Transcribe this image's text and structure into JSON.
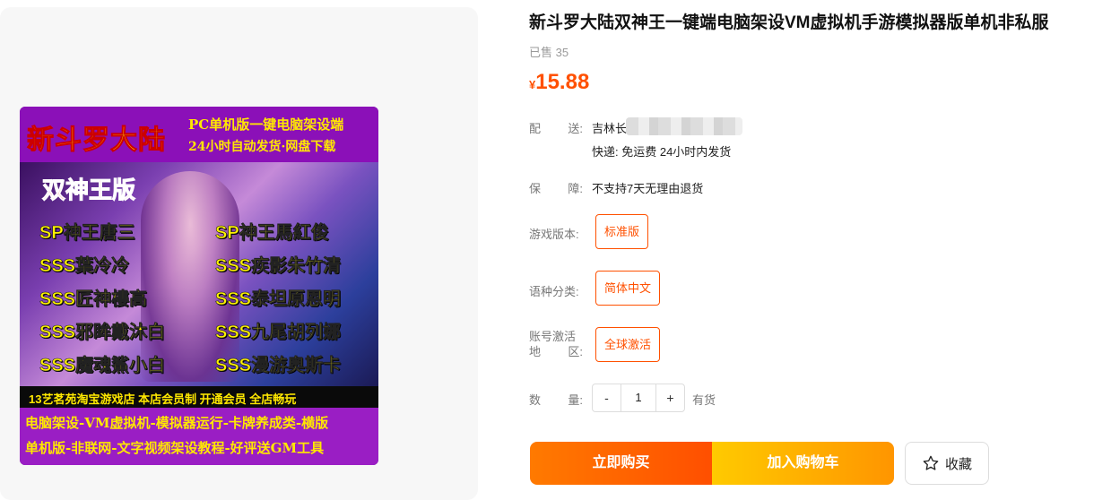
{
  "gallery": {
    "cover": {
      "title": "新斗罗大陆",
      "subtitle_line1": "PC单机版一键电脑架设端",
      "subtitle_line2": "24小时自动发货·网盘下载",
      "badge": "双神王版",
      "heroes_left": [
        "SP神王唐三",
        "SSS葉冷冷",
        "SSS匠神樓高",
        "SSS邪眸戴沐白",
        "SSS魔魂鯊小白"
      ],
      "heroes_right": [
        "SP神王馬紅俊",
        "SSS疾影朱竹清",
        "SSS泰坦原恩明",
        "SSS九尾胡列娜",
        "SSS漫游奥斯卡"
      ],
      "strip": "13艺茗苑淘宝游戏店  本店会员制  开通会员  全店畅玩",
      "bottom_line1": "电脑架设-VM虚拟机-模拟器运行-卡牌养成类-横版",
      "bottom_line2": "单机版-非联网-文字视频架设教程-好评送GM工具"
    }
  },
  "product": {
    "title": "新斗罗大陆双神王一键端电脑架设VM虚拟机手游模拟器版单机非私服",
    "sold": "已售 35",
    "price_currency": "¥",
    "price_value": "15.88"
  },
  "delivery": {
    "label_a": "配",
    "label_b": "送:",
    "location": "吉林长",
    "shipping": "快递: 免运费  24小时内发货"
  },
  "guarantee": {
    "label_a": "保",
    "label_b": "障:",
    "value": "不支持7天无理由退货"
  },
  "options": {
    "version_label": "游戏版本:",
    "version_value": "标准版",
    "language_label": "语种分类:",
    "language_value": "简体中文",
    "region_label_line1": "账号激活",
    "region_label_line2a": "地",
    "region_label_line2b": "区:",
    "region_value": "全球激活"
  },
  "quantity": {
    "label_a": "数",
    "label_b": "量:",
    "minus": "-",
    "value": "1",
    "plus": "+",
    "stock": "有货"
  },
  "actions": {
    "buy": "立即购买",
    "cart": "加入购物车",
    "favorite": "收藏",
    "favorite_icon": "star-outline-icon"
  },
  "colors": {
    "accent": "#ff5000",
    "buy_gradient": [
      "#ff7a00",
      "#ff4f00"
    ],
    "cart_gradient": [
      "#ffca00",
      "#ff9500"
    ]
  }
}
